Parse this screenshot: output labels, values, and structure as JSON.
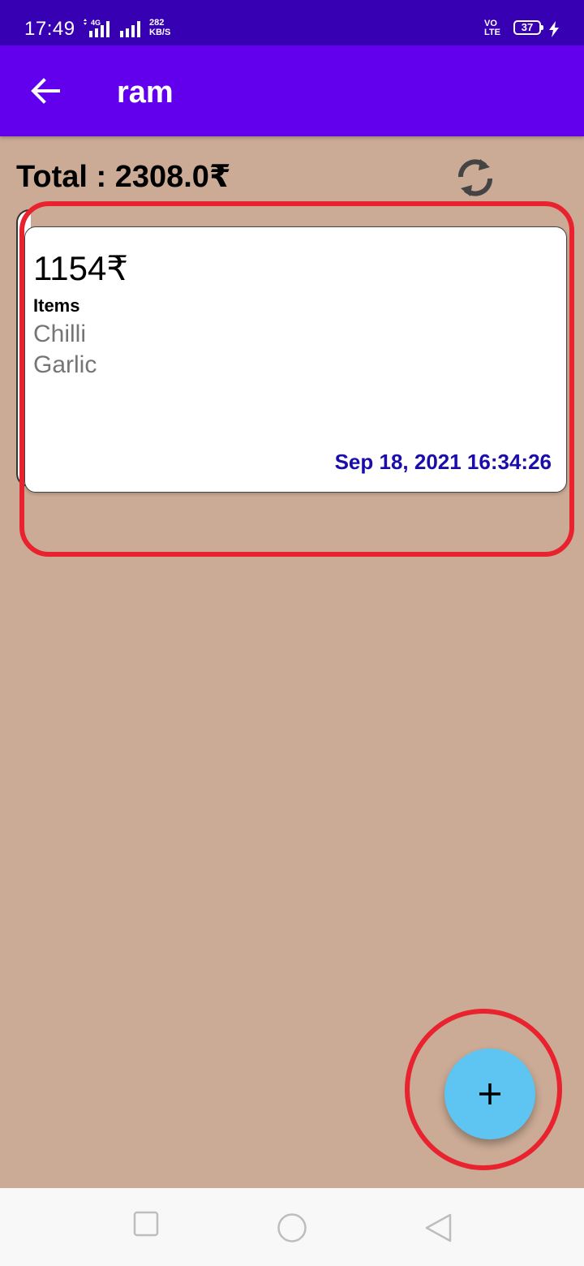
{
  "status_bar": {
    "time": "17:49",
    "network_type": "4G",
    "net_speed_value": "282",
    "net_speed_unit": "KB/S",
    "volte_top": "VO",
    "volte_bottom": "LTE",
    "battery_level": "37",
    "icons": [
      "signal-icon",
      "signal-icon",
      "charging-icon"
    ]
  },
  "app_bar": {
    "title": "ram",
    "back_icon": "arrow-left-icon",
    "color": "#6200EE"
  },
  "summary": {
    "total_text": "Total : 2308.0₹",
    "refresh_icon": "refresh-icon"
  },
  "orders": [
    {
      "amount": "1154₹",
      "items_heading": "Items",
      "items": [
        "Chilli",
        "Garlic"
      ],
      "date": "Sep 18, 2021 16:34:26"
    }
  ],
  "fab": {
    "icon": "plus-icon",
    "color": "#5EC5F2"
  },
  "nav_bar": {
    "icons": [
      "square-icon",
      "circle-icon",
      "triangle-back-icon"
    ]
  },
  "colors": {
    "background": "#CBAB95",
    "status_bar": "#3700B3",
    "highlight": "#E8232F",
    "date_text": "#1A0DAB"
  }
}
